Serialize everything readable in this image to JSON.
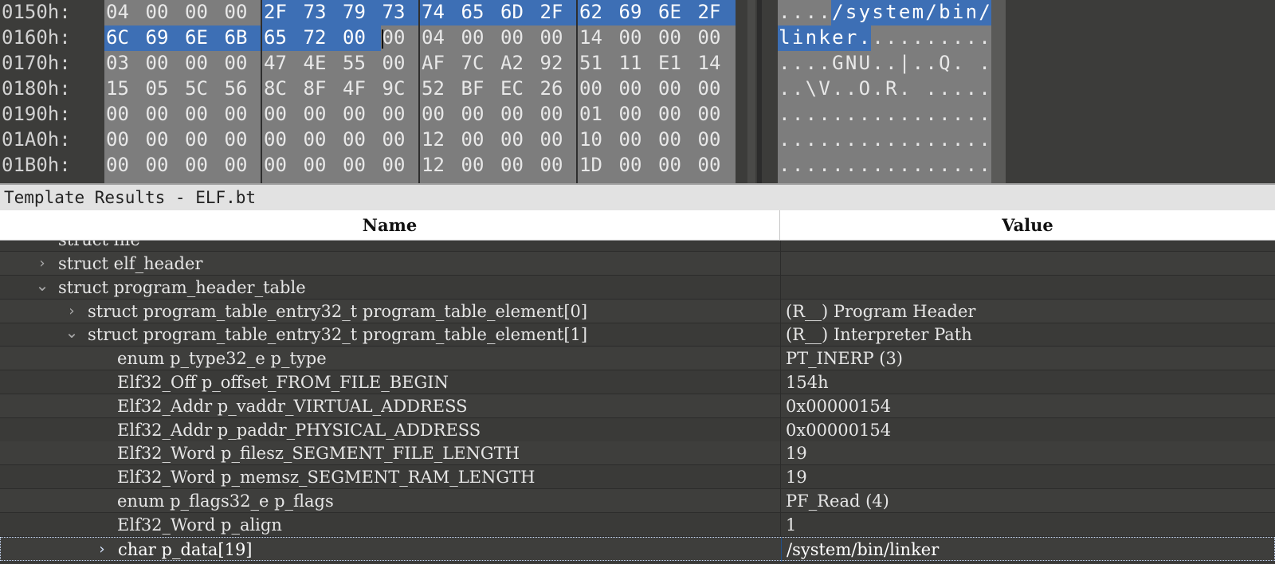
{
  "hex": {
    "rows": [
      {
        "addr": "0150h:",
        "bytes": [
          "04",
          "00",
          "00",
          "00",
          "2F",
          "73",
          "79",
          "73",
          "74",
          "65",
          "6D",
          "2F",
          "62",
          "69",
          "6E",
          "2F"
        ],
        "ascii": "..../system/bin/",
        "sel_bytes": [
          4,
          5,
          6,
          7,
          8,
          9,
          10,
          11,
          12,
          13,
          14,
          15
        ],
        "sel_ascii": [
          4,
          5,
          6,
          7,
          8,
          9,
          10,
          11,
          12,
          13,
          14,
          15
        ]
      },
      {
        "addr": "0160h:",
        "bytes": [
          "6C",
          "69",
          "6E",
          "6B",
          "65",
          "72",
          "00",
          "00",
          "04",
          "00",
          "00",
          "00",
          "14",
          "00",
          "00",
          "00"
        ],
        "ascii": "linker..........",
        "sel_bytes": [
          0,
          1,
          2,
          3,
          4,
          5,
          6
        ],
        "sel_ascii": [
          0,
          1,
          2,
          3,
          4,
          5,
          6
        ]
      },
      {
        "addr": "0170h:",
        "bytes": [
          "03",
          "00",
          "00",
          "00",
          "47",
          "4E",
          "55",
          "00",
          "AF",
          "7C",
          "A2",
          "92",
          "51",
          "11",
          "E1",
          "14"
        ],
        "ascii": "....GNU..|..Q. .",
        "sel_bytes": [],
        "sel_ascii": []
      },
      {
        "addr": "0180h:",
        "bytes": [
          "15",
          "05",
          "5C",
          "56",
          "8C",
          "8F",
          "4F",
          "9C",
          "52",
          "BF",
          "EC",
          "26",
          "00",
          "00",
          "00",
          "00"
        ],
        "ascii": "..\\V..O.R. .....",
        "sel_bytes": [],
        "sel_ascii": []
      },
      {
        "addr": "0190h:",
        "bytes": [
          "00",
          "00",
          "00",
          "00",
          "00",
          "00",
          "00",
          "00",
          "00",
          "00",
          "00",
          "00",
          "01",
          "00",
          "00",
          "00"
        ],
        "ascii": "................",
        "sel_bytes": [],
        "sel_ascii": []
      },
      {
        "addr": "01A0h:",
        "bytes": [
          "00",
          "00",
          "00",
          "00",
          "00",
          "00",
          "00",
          "00",
          "12",
          "00",
          "00",
          "00",
          "10",
          "00",
          "00",
          "00"
        ],
        "ascii": "................",
        "sel_bytes": [],
        "sel_ascii": []
      },
      {
        "addr": "01B0h:",
        "bytes": [
          "00",
          "00",
          "00",
          "00",
          "00",
          "00",
          "00",
          "00",
          "12",
          "00",
          "00",
          "00",
          "1D",
          "00",
          "00",
          "00"
        ],
        "ascii": "................",
        "sel_bytes": [],
        "sel_ascii": []
      }
    ],
    "colors": {
      "selection": "#3d6fb5",
      "panel": "#7d7d7d",
      "background": "#3c3c3a"
    }
  },
  "template": {
    "title": "Template Results - ELF.bt",
    "col_name": "Name",
    "col_value": "Value"
  },
  "tree": [
    {
      "indent": 1,
      "chevron": "",
      "name": "struct file",
      "value": "",
      "partial": true
    },
    {
      "indent": 1,
      "chevron": "chevron-right-icon",
      "name": "struct elf_header",
      "value": ""
    },
    {
      "indent": 1,
      "chevron": "chevron-down-icon",
      "name": "struct program_header_table",
      "value": ""
    },
    {
      "indent": 2,
      "chevron": "chevron-right-icon",
      "name": "struct program_table_entry32_t program_table_element[0]",
      "value": "(R__) Program Header"
    },
    {
      "indent": 2,
      "chevron": "chevron-down-icon",
      "name": "struct program_table_entry32_t program_table_element[1]",
      "value": "(R__) Interpreter Path"
    },
    {
      "indent": 3,
      "chevron": "",
      "name": "enum p_type32_e p_type",
      "value": "PT_INERP (3)"
    },
    {
      "indent": 3,
      "chevron": "",
      "name": "Elf32_Off p_offset_FROM_FILE_BEGIN",
      "value": "154h"
    },
    {
      "indent": 3,
      "chevron": "",
      "name": "Elf32_Addr p_vaddr_VIRTUAL_ADDRESS",
      "value": "0x00000154"
    },
    {
      "indent": 3,
      "chevron": "",
      "name": "Elf32_Addr p_paddr_PHYSICAL_ADDRESS",
      "value": "0x00000154"
    },
    {
      "indent": 3,
      "chevron": "",
      "name": "Elf32_Word p_filesz_SEGMENT_FILE_LENGTH",
      "value": "19"
    },
    {
      "indent": 3,
      "chevron": "",
      "name": "Elf32_Word p_memsz_SEGMENT_RAM_LENGTH",
      "value": "19"
    },
    {
      "indent": 3,
      "chevron": "",
      "name": "enum p_flags32_e p_flags",
      "value": "PF_Read (4)"
    },
    {
      "indent": 3,
      "chevron": "",
      "name": "Elf32_Word p_align",
      "value": "1"
    },
    {
      "indent": 3,
      "chevron": "chevron-right-icon",
      "name": "char p_data[19]",
      "value": "/system/bin/linker",
      "selected": true
    }
  ]
}
